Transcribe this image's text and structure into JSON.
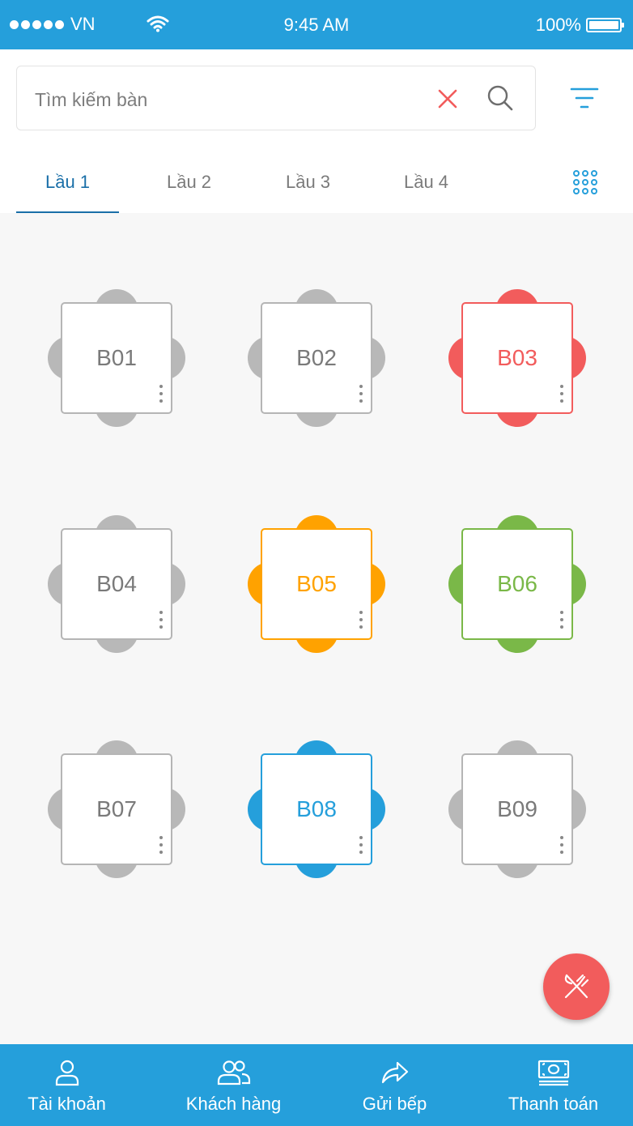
{
  "status_bar": {
    "carrier": "VN",
    "time": "9:45 AM",
    "battery": "100%"
  },
  "search": {
    "placeholder": "Tìm kiếm bàn",
    "value": ""
  },
  "icons": {
    "clear": "close-icon",
    "search": "search-icon",
    "filter": "filter-icon",
    "grid": "grid-icon",
    "fab": "fork-knife-icon"
  },
  "tabs": [
    {
      "label": "Lầu 1",
      "active": true
    },
    {
      "label": "Lầu 2",
      "active": false
    },
    {
      "label": "Lầu 3",
      "active": false
    },
    {
      "label": "Lầu 4",
      "active": false
    }
  ],
  "status_colors": {
    "empty": "#b8b8b8",
    "red": "#f25c5c",
    "orange": "#ffa200",
    "green": "#7ab848",
    "blue": "#259fdb"
  },
  "tables": [
    {
      "name": "B01",
      "status": "empty"
    },
    {
      "name": "B02",
      "status": "empty"
    },
    {
      "name": "B03",
      "status": "red"
    },
    {
      "name": "B04",
      "status": "empty"
    },
    {
      "name": "B05",
      "status": "orange"
    },
    {
      "name": "B06",
      "status": "green"
    },
    {
      "name": "B07",
      "status": "empty"
    },
    {
      "name": "B08",
      "status": "blue"
    },
    {
      "name": "B09",
      "status": "empty"
    }
  ],
  "bottom_nav": [
    {
      "label": "Tài khoản",
      "icon": "user-icon"
    },
    {
      "label": "Khách hàng",
      "icon": "users-icon"
    },
    {
      "label": "Gửi bếp",
      "icon": "share-arrow-icon"
    },
    {
      "label": "Thanh toán",
      "icon": "cash-icon"
    }
  ],
  "colors": {
    "primary": "#259fdb",
    "active_tab": "#1a6fa8",
    "fab": "#f25c5c"
  }
}
